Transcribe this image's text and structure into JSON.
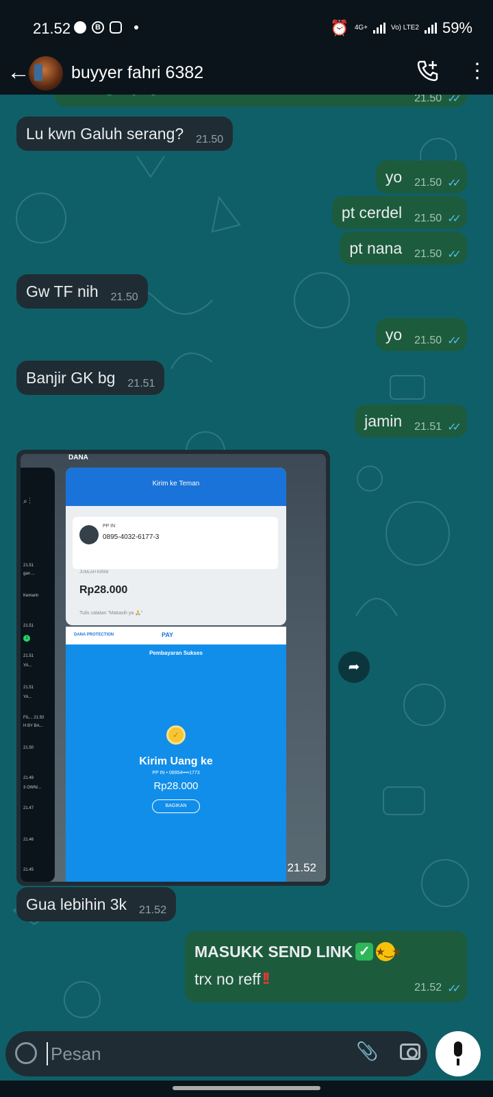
{
  "status": {
    "time": "21.52",
    "battery": "59%",
    "net1": "4G+",
    "net2": "Vo) LTE2"
  },
  "header": {
    "contact_name": "buyyer fahri 6382"
  },
  "messages": [
    {
      "dir": "out",
      "text": "selengkapnya",
      "time": "21.50"
    },
    {
      "dir": "in",
      "text": "Lu kwn Galuh serang?",
      "time": "21.50"
    },
    {
      "dir": "out",
      "text": "yo",
      "time": "21.50"
    },
    {
      "dir": "out",
      "text": "pt cerdel",
      "time": "21.50"
    },
    {
      "dir": "out",
      "text": "pt nana",
      "time": "21.50"
    },
    {
      "dir": "in",
      "text": "Gw TF nih",
      "time": "21.50"
    },
    {
      "dir": "out",
      "text": "yo",
      "time": "21.50"
    },
    {
      "dir": "in",
      "text": "Banjir GK bg",
      "time": "21.51"
    },
    {
      "dir": "out",
      "text": "jamin",
      "time": "21.51"
    },
    {
      "dir": "in",
      "text": "Gua lebihin 3k",
      "time": "21.52"
    }
  ],
  "image_message": {
    "time": "21.52",
    "app_label": "DANA",
    "screen_title": "Kirim ke Teman",
    "recipient_label": "PP IN",
    "recipient_phone": "0895-4032-6177-3",
    "amount_label": "JUMLAH KIRIM",
    "amount": "Rp28.000",
    "note_placeholder": "Tulis catatan \"Makasih ya 🙏\"",
    "protection_label": "DANA PROTECTION",
    "pay_label": "PAY",
    "success_label": "Pembayaran Sukses",
    "send_title": "Kirim Uang ke",
    "masked_phone": "PP IN • 08954••••1773",
    "amount2": "Rp28.000",
    "share_label": "BAGIKAN",
    "left_panel": [
      "21.51",
      "gan ...",
      "Kemarin",
      "21.51",
      "21.51",
      "YA...",
      "21.51",
      "YA...",
      "FIL... 21.50",
      "H BY BA...",
      "21.50",
      "21.49",
      "3 OWN/...",
      "21.47",
      "21.46",
      "21.45"
    ]
  },
  "last_message": {
    "line1": "MASUKK SEND LINK",
    "line2": "trx no reff",
    "bangs": "!!",
    "time": "21.52"
  },
  "input": {
    "placeholder": "Pesan"
  },
  "colors": {
    "chat_bg": "#0f5f68",
    "incoming": "#202c33",
    "outgoing": "#1d5b3d",
    "ticks": "#53bdeb"
  }
}
